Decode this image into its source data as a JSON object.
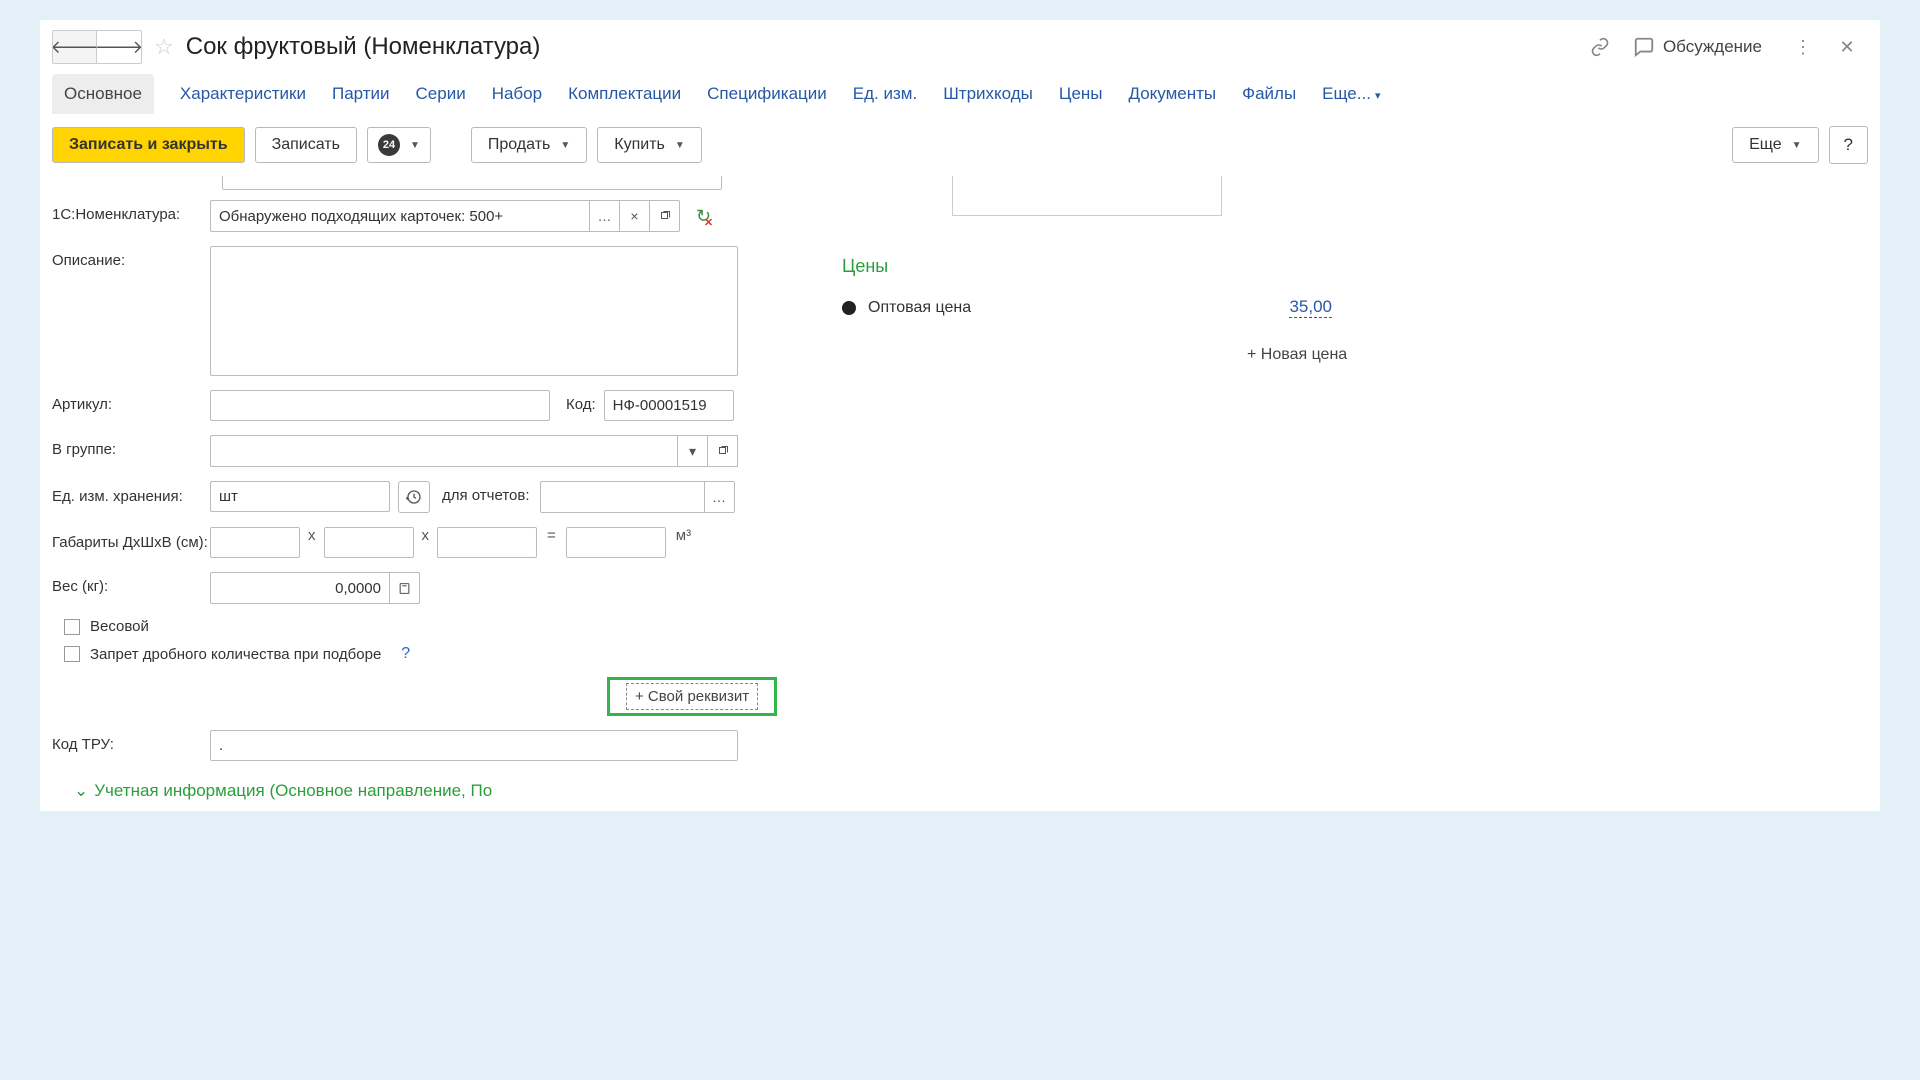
{
  "header": {
    "title": "Сок фруктовый (Номенклатура)",
    "discuss": "Обсуждение"
  },
  "tabs": {
    "main": "Основное",
    "characteristics": "Характеристики",
    "batches": "Партии",
    "series": "Серии",
    "set": "Набор",
    "completions": "Комплектации",
    "specifications": "Спецификации",
    "units": "Ед. изм.",
    "barcodes": "Штрихкоды",
    "prices": "Цены",
    "documents": "Документы",
    "files": "Файлы",
    "more": "Еще..."
  },
  "actions": {
    "save_close": "Записать и закрыть",
    "save": "Записать",
    "badge": "24",
    "sell": "Продать",
    "buy": "Купить",
    "more": "Еще",
    "help": "?"
  },
  "form": {
    "nomenclature_label": "1С:Номенклатура:",
    "nomenclature_placeholder": "Обнаружено подходящих карточек: 500+",
    "description_label": "Описание:",
    "article_label": "Артикул:",
    "code_label": "Код:",
    "code_value": "НФ-00001519",
    "group_label": "В группе:",
    "storage_unit_label": "Ед. изм. хранения:",
    "storage_unit_value": "шт",
    "reports_label": "для отчетов:",
    "dimensions_label": "Габариты ДхШхВ (см):",
    "dim_sep": "х",
    "eq": "=",
    "m3": "м³",
    "weight_label": "Вес (кг):",
    "weight_value": "0,0000",
    "weight_checkbox": "Весовой",
    "fractional_checkbox": "Запрет дробного количества при подборе",
    "custom_requisite": "+ Свой реквизит",
    "tru_label": "Код ТРУ:",
    "tru_value": ".",
    "section": "Учетная информация (Основное направление, По"
  },
  "prices": {
    "header": "Цены",
    "wholesale_label": "Оптовая цена",
    "wholesale_value": "35,00",
    "new_price": "+ Новая цена"
  }
}
